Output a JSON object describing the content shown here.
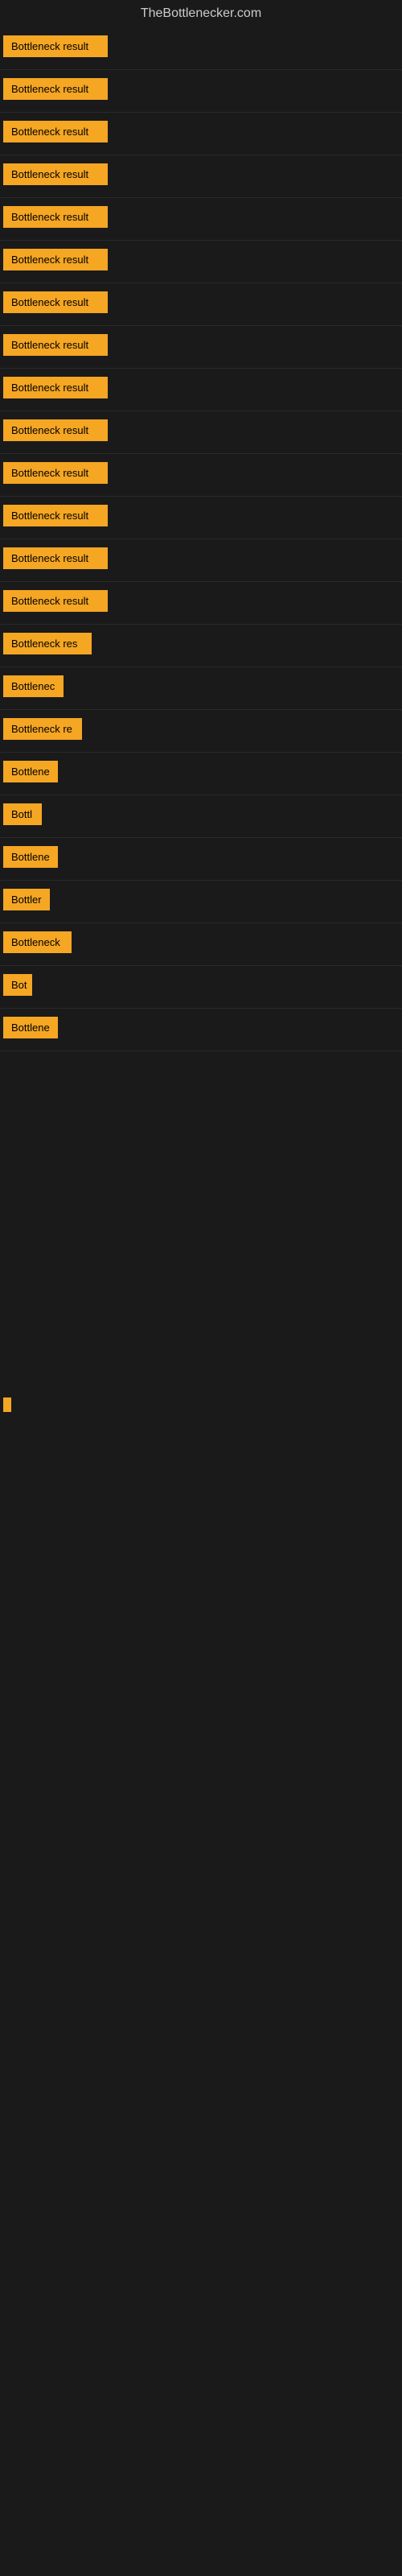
{
  "site": {
    "title": "TheBottlenecker.com"
  },
  "items": [
    {
      "label": "Bottleneck result",
      "width": 130,
      "row_height": "normal"
    },
    {
      "label": "Bottleneck result",
      "width": 130,
      "row_height": "normal"
    },
    {
      "label": "Bottleneck result",
      "width": 130,
      "row_height": "normal"
    },
    {
      "label": "Bottleneck result",
      "width": 130,
      "row_height": "normal"
    },
    {
      "label": "Bottleneck result",
      "width": 130,
      "row_height": "normal"
    },
    {
      "label": "Bottleneck result",
      "width": 130,
      "row_height": "normal"
    },
    {
      "label": "Bottleneck result",
      "width": 130,
      "row_height": "normal"
    },
    {
      "label": "Bottleneck result",
      "width": 130,
      "row_height": "normal"
    },
    {
      "label": "Bottleneck result",
      "width": 130,
      "row_height": "normal"
    },
    {
      "label": "Bottleneck result",
      "width": 130,
      "row_height": "normal"
    },
    {
      "label": "Bottleneck result",
      "width": 130,
      "row_height": "normal"
    },
    {
      "label": "Bottleneck result",
      "width": 130,
      "row_height": "normal"
    },
    {
      "label": "Bottleneck result",
      "width": 130,
      "row_height": "normal"
    },
    {
      "label": "Bottleneck result",
      "width": 130,
      "row_height": "normal"
    },
    {
      "label": "Bottleneck res",
      "width": 110,
      "row_height": "normal"
    },
    {
      "label": "Bottlenec",
      "width": 75,
      "row_height": "normal"
    },
    {
      "label": "Bottleneck re",
      "width": 98,
      "row_height": "normal"
    },
    {
      "label": "Bottlene",
      "width": 68,
      "row_height": "normal"
    },
    {
      "label": "Bottl",
      "width": 48,
      "row_height": "normal"
    },
    {
      "label": "Bottlene",
      "width": 68,
      "row_height": "normal"
    },
    {
      "label": "Bottler",
      "width": 58,
      "row_height": "normal"
    },
    {
      "label": "Bottleneck",
      "width": 85,
      "row_height": "normal"
    },
    {
      "label": "Bot",
      "width": 36,
      "row_height": "normal"
    },
    {
      "label": "Bottlene",
      "width": 68,
      "row_height": "normal"
    }
  ],
  "bottom_bar": {
    "width": 10,
    "color": "#f5a623"
  }
}
